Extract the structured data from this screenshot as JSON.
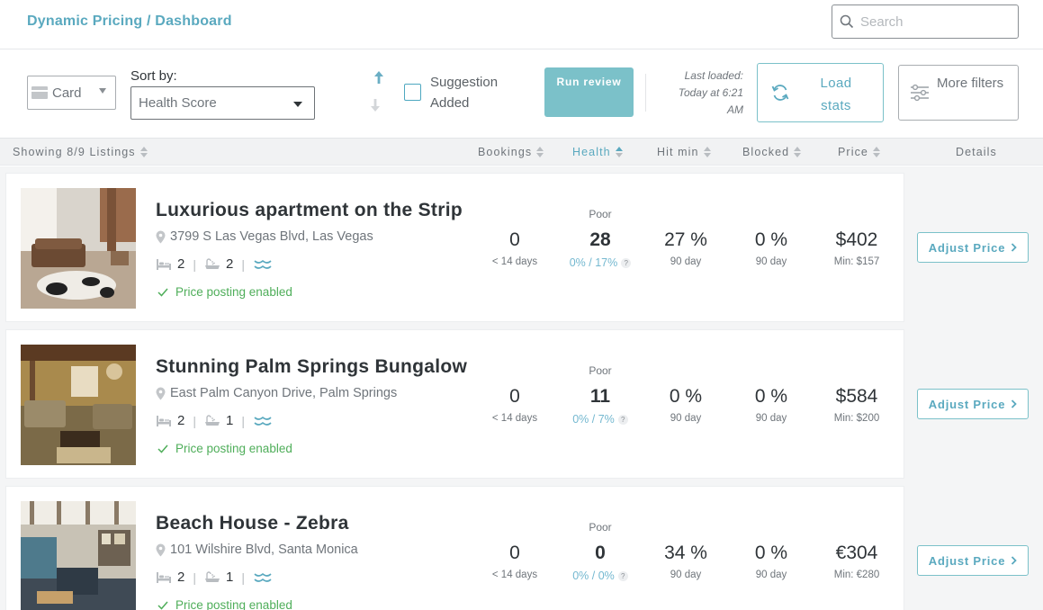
{
  "header": {
    "breadcrumb": "Dynamic Pricing / Dashboard",
    "search_placeholder": "Search"
  },
  "toolbar": {
    "view_value": "Card",
    "sort_label": "Sort by:",
    "sort_value": "Health Score",
    "suggestion_label": "Suggestion Added",
    "run_review_label": "Run review",
    "last_loaded": "Last loaded: Today at 6:21 AM",
    "load_stats_label": "Load stats",
    "more_filters_label": "More filters"
  },
  "columns": {
    "showing": "Showing 8/9 Listings",
    "bookings": "Bookings",
    "health": "Health",
    "hit_min": "Hit min",
    "blocked": "Blocked",
    "price": "Price",
    "details": "Details"
  },
  "listings": [
    {
      "title": "Luxurious apartment on the Strip",
      "address": "3799 S Las Vegas Blvd, Las Vegas",
      "beds": "2",
      "baths": "2",
      "posting": "Price posting enabled",
      "bookings": "0",
      "bookings_sub": "< 14 days",
      "health_label": "Poor",
      "health": "28",
      "health_sub": "0% / 17%",
      "hit_min": "27 %",
      "hit_min_sub": "90 day",
      "blocked": "0 %",
      "blocked_sub": "90 day",
      "price": "$402",
      "price_min": "Min: $157",
      "adjust_label": "Adjust Price"
    },
    {
      "title": "Stunning Palm Springs Bungalow",
      "address": "East Palm Canyon Drive, Palm Springs",
      "beds": "2",
      "baths": "1",
      "posting": "Price posting enabled",
      "bookings": "0",
      "bookings_sub": "< 14 days",
      "health_label": "Poor",
      "health": "11",
      "health_sub": "0% / 7%",
      "hit_min": "0 %",
      "hit_min_sub": "90 day",
      "blocked": "0 %",
      "blocked_sub": "90 day",
      "price": "$584",
      "price_min": "Min: $200",
      "adjust_label": "Adjust Price"
    },
    {
      "title": "Beach House - Zebra",
      "address": "101 Wilshire Blvd, Santa Monica",
      "beds": "2",
      "baths": "1",
      "posting": "Price posting enabled",
      "bookings": "0",
      "bookings_sub": "< 14 days",
      "health_label": "Poor",
      "health": "0",
      "health_sub": "0% / 0%",
      "hit_min": "34 %",
      "hit_min_sub": "90 day",
      "blocked": "0 %",
      "blocked_sub": "90 day",
      "price": "€304",
      "price_min": "Min: €280",
      "adjust_label": "Adjust Price"
    }
  ],
  "colors": {
    "accent": "#5aa9bf",
    "button_teal": "#7bc1c9",
    "success": "#4fae5a"
  }
}
